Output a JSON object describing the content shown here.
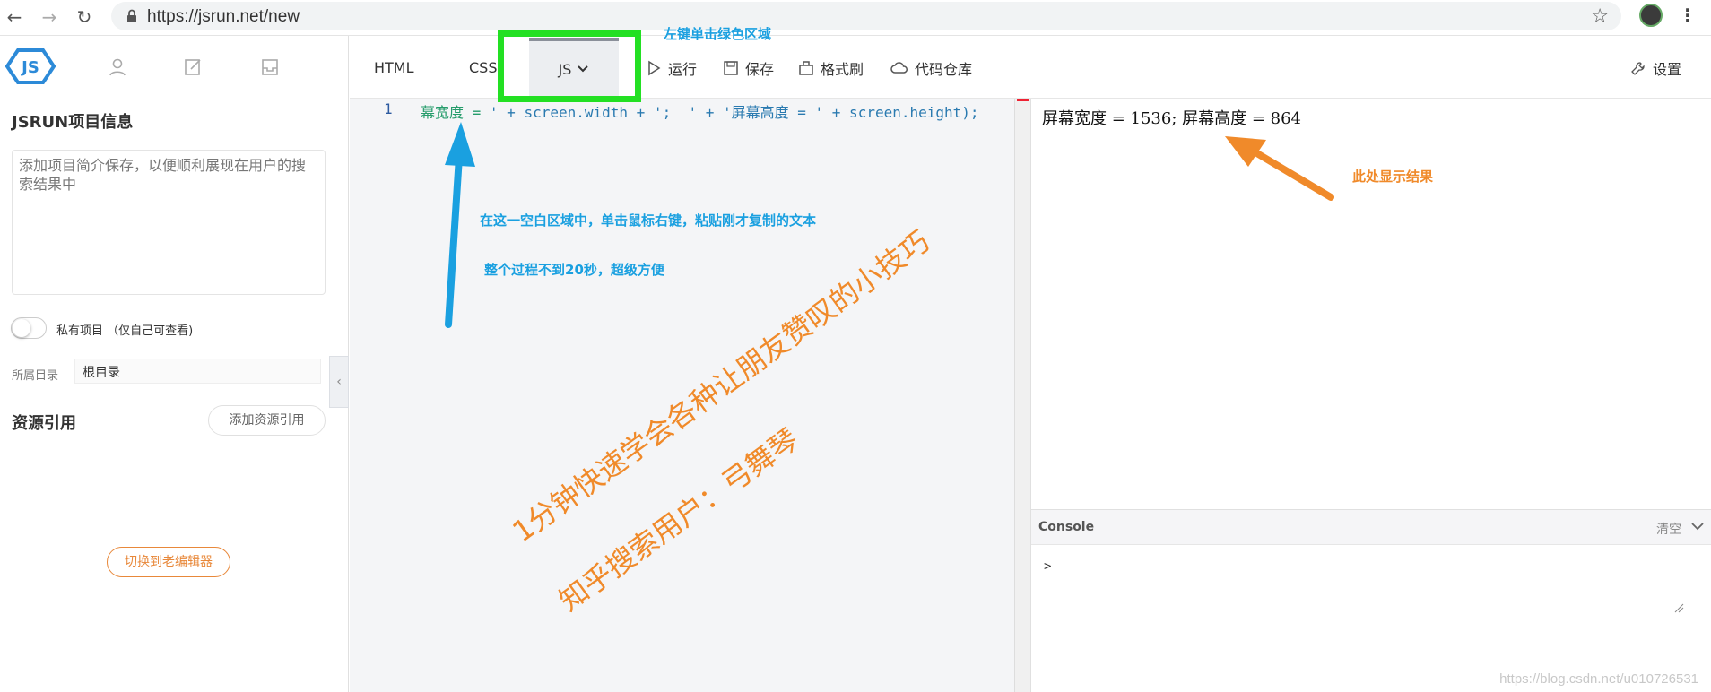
{
  "browser": {
    "url": "https://jsrun.net/new",
    "icons": [
      "back-arrow-icon",
      "forward-arrow-icon",
      "reload-icon",
      "lock-icon",
      "star-icon",
      "menu-icon"
    ]
  },
  "sidebar": {
    "project_title": "JSRUN项目信息",
    "description_placeholder": "添加项目简介保存，以便顺利展现在用户的搜索结果中",
    "private_label": "私有项目 （仅自己可查看)",
    "directory_label": "所属目录",
    "directory_value": "根目录",
    "resources_title": "资源引用",
    "add_resource_label": "添加资源引用",
    "old_editor_label": "切换到老编辑器",
    "collapse_symbol": "‹"
  },
  "toolbar": {
    "tab_html": "HTML",
    "tab_css": "CSS",
    "tab_js": "JS",
    "run_label": "运行",
    "save_label": "保存",
    "format_label": "格式刷",
    "repo_label": "代码仓库",
    "settings_label": "设置"
  },
  "editor": {
    "line_number": "1",
    "code_string_1": "幕宽度 = ",
    "code_rest": "' + screen.width + ';  ' + '屏幕高度 = ' + screen.height);"
  },
  "result": {
    "text": "屏幕宽度 = 1536; 屏幕高度 = 864"
  },
  "console": {
    "title": "Console",
    "clear_label": "清空",
    "prompt": ">"
  },
  "annotations": {
    "green_box_note": "左键单击绿色区域",
    "paste_note": "在这一空白区域中，单击鼠标右键，粘贴刚才复制的文本",
    "time_note": "整个过程不到20秒，超级方便",
    "result_note": "此处显示结果",
    "big_title": "1分钟快速学会各种让朋友赞叹的小技巧",
    "search_note": "知乎搜索用户：弓舞琴",
    "colors": {
      "blue": "#1aa0e0",
      "orange": "#f08a2a",
      "green": "#23e023"
    }
  },
  "watermark": "https://blog.csdn.net/u010726531"
}
